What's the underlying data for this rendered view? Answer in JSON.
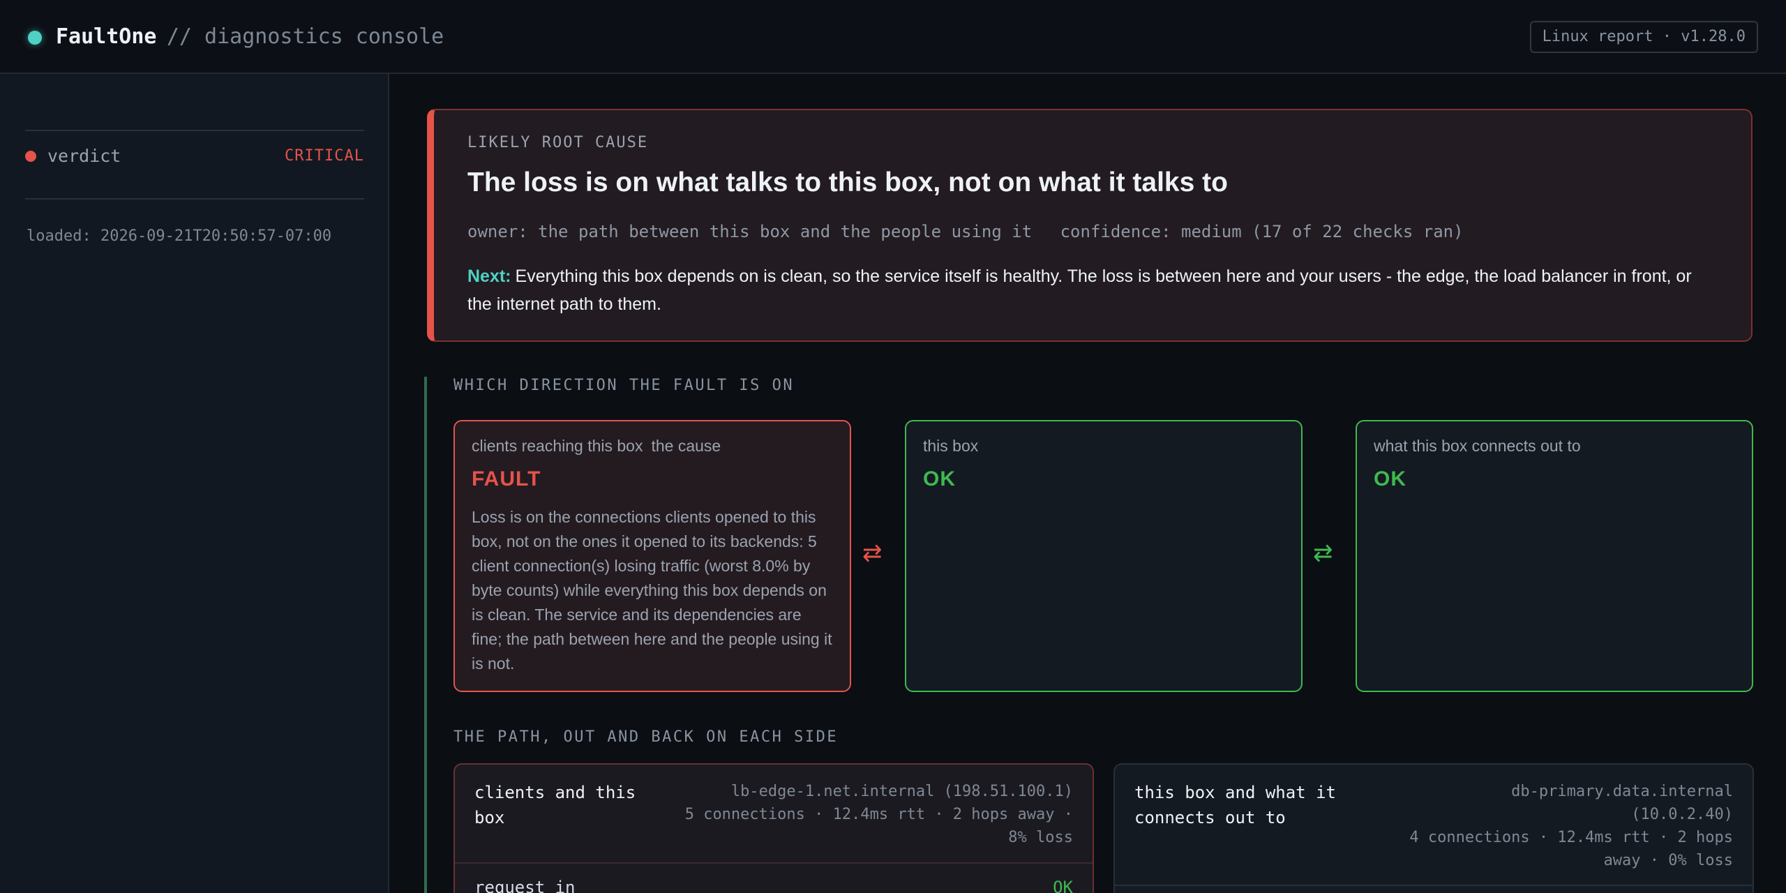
{
  "header": {
    "app_name": "FaultOne",
    "subtitle": "// diagnostics console",
    "version_chip": "Linux report · v1.28.0"
  },
  "sidebar": {
    "verdict_label": "verdict",
    "verdict_badge": "CRITICAL",
    "loaded": "loaded: 2026-09-21T20:50:57-07:00"
  },
  "root_cause": {
    "eyebrow": "LIKELY ROOT CAUSE",
    "title": "The loss is on what talks to this box, not on what it talks to",
    "owner": "owner: the path between this box and the people using it",
    "confidence": "confidence: medium (17 of 22 checks ran)",
    "next_label": "Next:",
    "next_text": "Everything this box depends on is clean, so the service itself is healthy. The loss is between here and your users - the edge, the load balancer in front, or the internet path to them."
  },
  "direction": {
    "heading": "WHICH DIRECTION THE FAULT IS ON",
    "arrow_glyph": "⇄",
    "cards": [
      {
        "label": "clients reaching this box",
        "cause_tag": "the cause",
        "status": "FAULT",
        "description": "Loss is on the connections clients opened to this box, not on the ones it opened to its backends: 5 client connection(s) losing traffic (worst 8.0% by byte counts) while everything this box depends on is clean. The service and its dependencies are fine; the path between here and the people using it is not."
      },
      {
        "label": "this box",
        "status": "OK"
      },
      {
        "label": "what this box connects out to",
        "status": "OK"
      }
    ]
  },
  "path": {
    "heading": "THE PATH, OUT AND BACK ON EACH SIDE",
    "cards": [
      {
        "title_line1": "clients and this",
        "title_line2": "box",
        "info_line1": "lb-edge-1.net.internal (198.51.100.1)",
        "info_line2": "5 connections · 12.4ms rtt · 2 hops away ·",
        "info_line3": "8% loss",
        "row_label": "request in",
        "row_status": "OK"
      },
      {
        "title_line1": "this box and what it",
        "title_line2": "connects out to",
        "info_line1": "db-primary.data.internal",
        "info_line2": "(10.0.2.40)",
        "info_line3": "4 connections · 12.4ms rtt · 2 hops",
        "info_line4": "away · 0% loss"
      }
    ]
  },
  "colors": {
    "accent": "#4fd1c5",
    "fault": "#e5534b",
    "ok": "#3fb950"
  }
}
